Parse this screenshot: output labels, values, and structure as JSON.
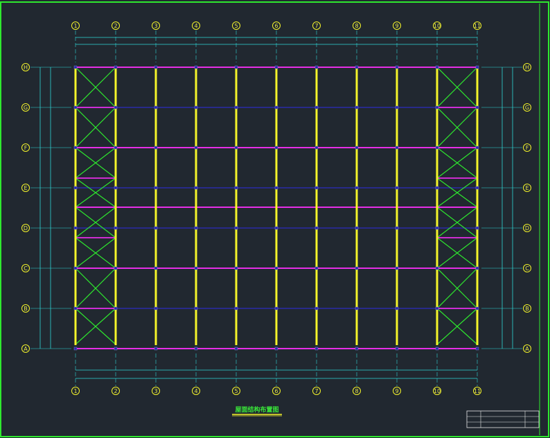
{
  "drawing": {
    "title": "屋面结构布置图",
    "colors": {
      "background": "#212830",
      "frame": "#2ee82e",
      "column_line": "#f5f52a",
      "rafter_line": "#e62ee6",
      "purlin_line": "#2a2aa8",
      "bracing": "#2ee82e",
      "dimension": "#2fd6d6",
      "bubble": "#f5f52a",
      "title_text": "#39e639"
    }
  },
  "grid": {
    "columns": [
      "1",
      "2",
      "3",
      "4",
      "5",
      "6",
      "7",
      "8",
      "9",
      "10",
      "11"
    ],
    "rows": [
      "H",
      "G",
      "F",
      "E",
      "D",
      "C",
      "B",
      "A"
    ]
  },
  "layout_flags": {
    "bracing_bays": [
      "1-2",
      "10-11"
    ],
    "title_block_rows": 3
  }
}
